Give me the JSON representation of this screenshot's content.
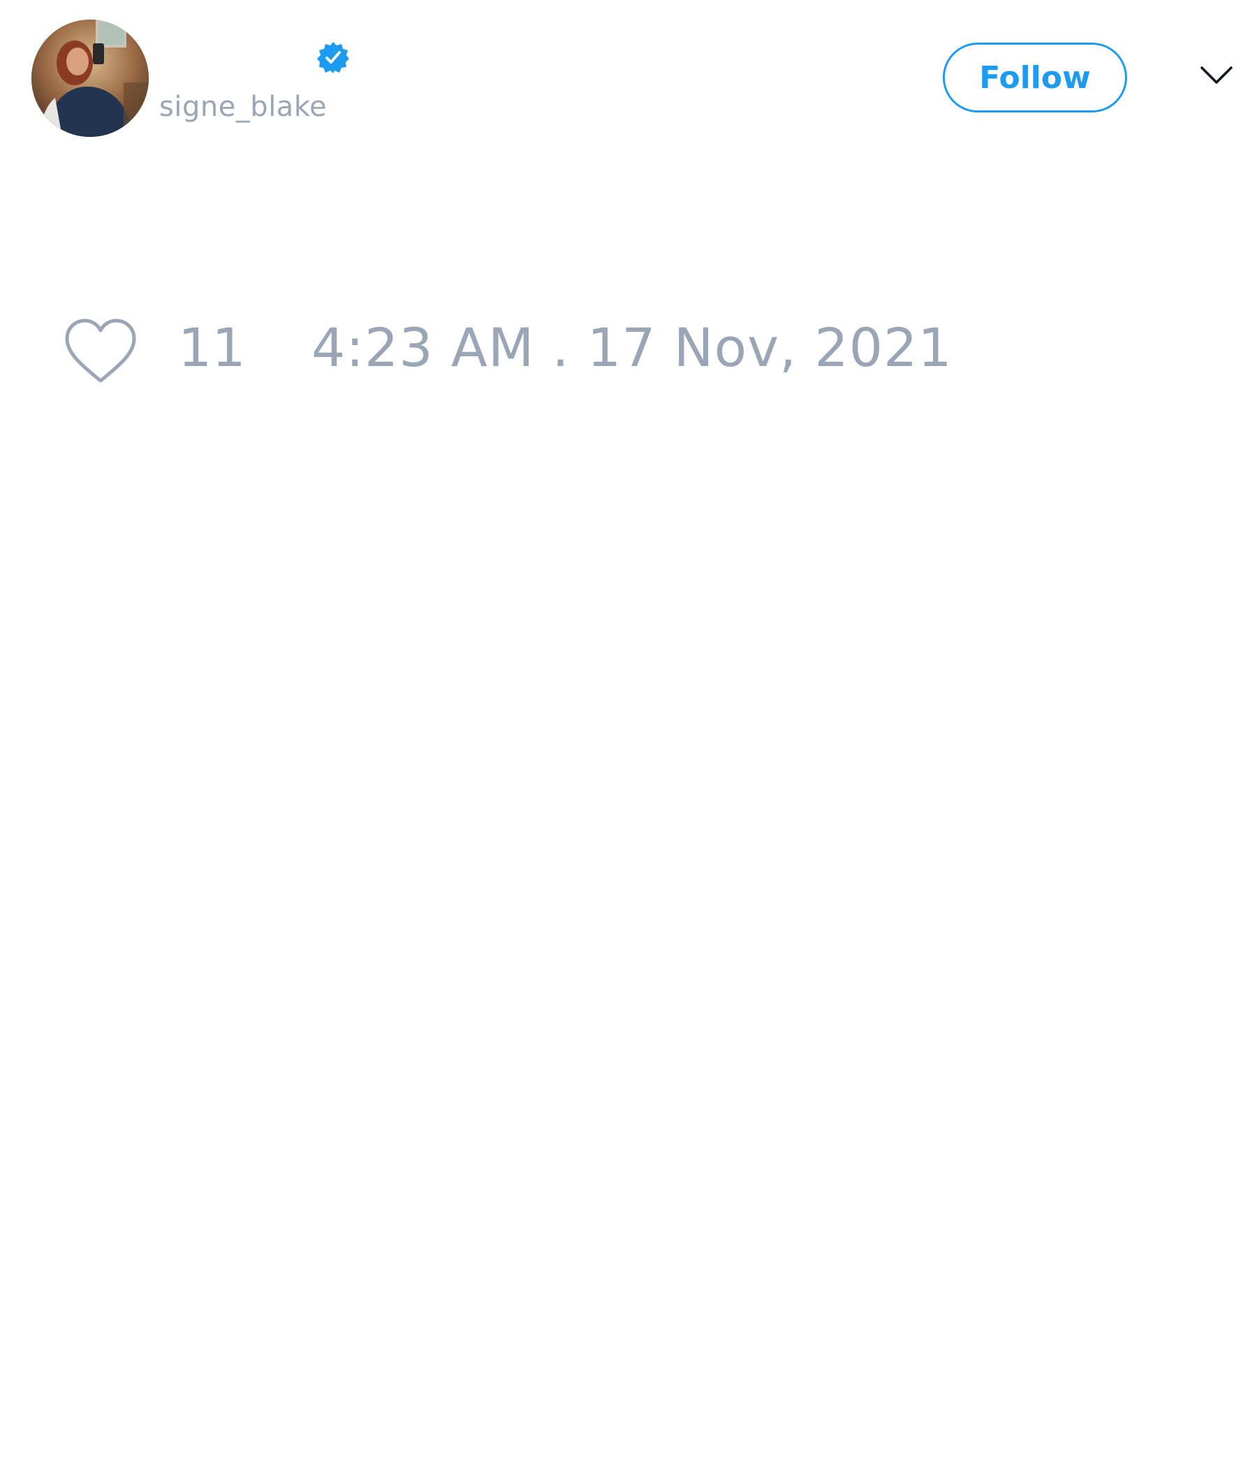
{
  "user": {
    "display_name": "",
    "handle": "signe_blake",
    "verified": true,
    "avatar_icon": "profile-photo"
  },
  "header": {
    "follow_label": "Follow",
    "menu_icon": "chevron-down-icon"
  },
  "tweet": {
    "like_icon": "heart-outline-icon",
    "like_count": "11",
    "timestamp": "4:23 AM . 17 Nov, 2021"
  },
  "colors": {
    "accent": "#1d9bf0",
    "muted_text": "#9aa6b6",
    "background": "#ffffff"
  }
}
